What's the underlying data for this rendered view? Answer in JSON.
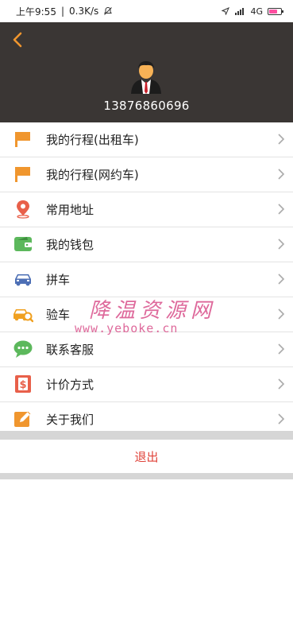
{
  "status_bar": {
    "time": "上午9:55",
    "speed": "0.3K/s",
    "network": "4G"
  },
  "header": {
    "back_icon": "chevron-left-icon",
    "avatar_icon": "businessman-avatar",
    "phone": "13876860696",
    "background": "#3a3634",
    "accent": "#f0962e"
  },
  "menu": {
    "items": [
      {
        "label": "我的行程(出租车)",
        "icon": "flag-icon"
      },
      {
        "label": "我的行程(网约车)",
        "icon": "flag-icon"
      },
      {
        "label": "常用地址",
        "icon": "location-pin-icon"
      },
      {
        "label": "我的钱包",
        "icon": "wallet-icon"
      },
      {
        "label": "拼车",
        "icon": "car-icon"
      },
      {
        "label": "验车",
        "icon": "car-inspect-icon"
      },
      {
        "label": "联系客服",
        "icon": "chat-icon"
      },
      {
        "label": "计价方式",
        "icon": "dollar-icon"
      },
      {
        "label": "关于我们",
        "icon": "edit-icon"
      }
    ]
  },
  "logout": {
    "label": "退出",
    "color": "#e0433a"
  },
  "watermark": {
    "title": "降温资源网",
    "url": "www.yeboke.cn"
  }
}
